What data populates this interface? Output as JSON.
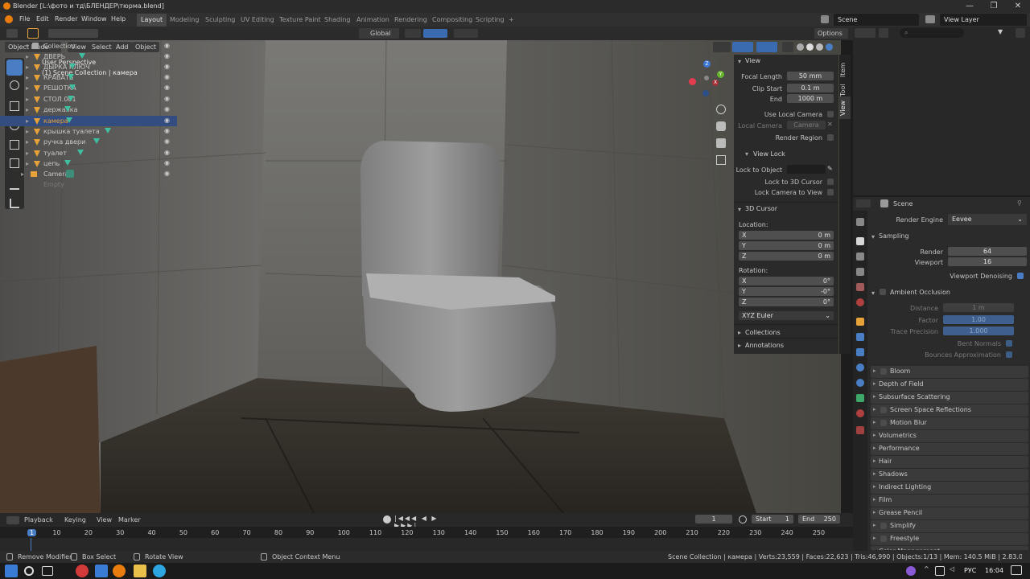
{
  "window": {
    "title": "Blender [L:\\фото и тд\\БЛЕНДЕР\\тюрма.blend]",
    "minimize": "—",
    "maximize": "❐",
    "close": "✕"
  },
  "menu": [
    "File",
    "Edit",
    "Render",
    "Window",
    "Help"
  ],
  "workspaces": [
    "Layout",
    "Modeling",
    "Sculpting",
    "UV Editing",
    "Texture Paint",
    "Shading",
    "Animation",
    "Rendering",
    "Compositing",
    "Scripting",
    "+"
  ],
  "scene": {
    "name": "Scene",
    "view_layer": "View Layer"
  },
  "header": {
    "orientation": "Global",
    "options": "Options"
  },
  "viewport_header": {
    "mode": "Object Mode",
    "view": "View",
    "select": "Select",
    "add": "Add",
    "object": "Object"
  },
  "overlay_text": {
    "perspective": "User Perspective",
    "collection": "(1) Scene Collection | камера"
  },
  "gizmo": {
    "x": "X",
    "y": "Y",
    "z": "Z"
  },
  "npanel": {
    "tabs": [
      "Item",
      "Tool",
      "View"
    ],
    "view_header": "View",
    "focal_length_label": "Focal Length",
    "focal_length": "50 mm",
    "clip_start_label": "Clip Start",
    "clip_start": "0.1 m",
    "end_label": "End",
    "end": "1000 m",
    "use_local_camera": "Use Local Camera",
    "local_camera_label": "Local Camera",
    "local_camera": "Camera",
    "render_region": "Render Region",
    "view_lock": "View Lock",
    "lock_to_object": "Lock to Object",
    "lock_3d_cursor": "Lock to 3D Cursor",
    "lock_camera": "Lock Camera to View",
    "cursor_header": "3D Cursor",
    "location": "Location:",
    "loc": [
      {
        "axis": "X",
        "value": "0 m"
      },
      {
        "axis": "Y",
        "value": "0 m"
      },
      {
        "axis": "Z",
        "value": "0 m"
      }
    ],
    "rotation": "Rotation:",
    "rot": [
      {
        "axis": "X",
        "value": "0°"
      },
      {
        "axis": "Y",
        "value": "-0°"
      },
      {
        "axis": "Z",
        "value": "0°"
      }
    ],
    "euler": "XYZ Euler",
    "collections": "Collections",
    "annotations": "Annotations"
  },
  "outliner": {
    "collection": "Collection",
    "items": [
      "ДВЕРЬ",
      "ДЫРКА КЛЮЧ",
      "КРАВАТЬ",
      "РЕШОТКА",
      "СТОЛ.001",
      "держалка",
      "камера",
      "крышка туалета",
      "ручка двери",
      "туалет",
      "цепь"
    ],
    "camera": "Camera",
    "empty": "Empty"
  },
  "properties": {
    "context": "Scene",
    "render_engine_label": "Render Engine",
    "render_engine": "Eevee",
    "sampling": "Sampling",
    "render_label": "Render",
    "render_samples": "64",
    "viewport_label": "Viewport",
    "viewport_samples": "16",
    "viewport_denoising": "Viewport Denoising",
    "ao": "Ambient Occlusion",
    "distance_label": "Distance",
    "distance": "1 m",
    "factor_label": "Factor",
    "factor": "1.00",
    "trace_label": "Trace Precision",
    "trace": "1.000",
    "bent_normals": "Bent Normals",
    "bounces": "Bounces Approximation",
    "sections": [
      "Bloom",
      "Depth of Field",
      "Subsurface Scattering",
      "Screen Space Reflections",
      "Motion Blur",
      "Volumetrics",
      "Performance",
      "Hair",
      "Shadows",
      "Indirect Lighting",
      "Film",
      "Grease Pencil",
      "Simplify",
      "Freestyle",
      "Color Management"
    ]
  },
  "timeline": {
    "playback": "Playback",
    "keying": "Keying",
    "view": "View",
    "marker": "Marker",
    "current_frame": "1",
    "start_label": "Start",
    "start": "1",
    "end_label": "End",
    "end": "250",
    "ruler": [
      "1",
      "10",
      "20",
      "30",
      "40",
      "50",
      "60",
      "70",
      "80",
      "90",
      "100",
      "110",
      "120",
      "130",
      "140",
      "150",
      "160",
      "170",
      "180",
      "190",
      "200",
      "210",
      "220",
      "230",
      "240",
      "250"
    ]
  },
  "status": {
    "remove_modifier": "Remove Modifier",
    "box_select": "Box Select",
    "rotate_view": "Rotate View",
    "context_menu": "Object Context Menu",
    "stats": "Scene Collection | камера | Verts:23,559 | Faces:22,623 | Tris:46,990 | Objects:1/13 | Mem: 140.5 MiB | 2.83.0"
  },
  "taskbar": {
    "lang": "РУС",
    "time": "16:04"
  }
}
